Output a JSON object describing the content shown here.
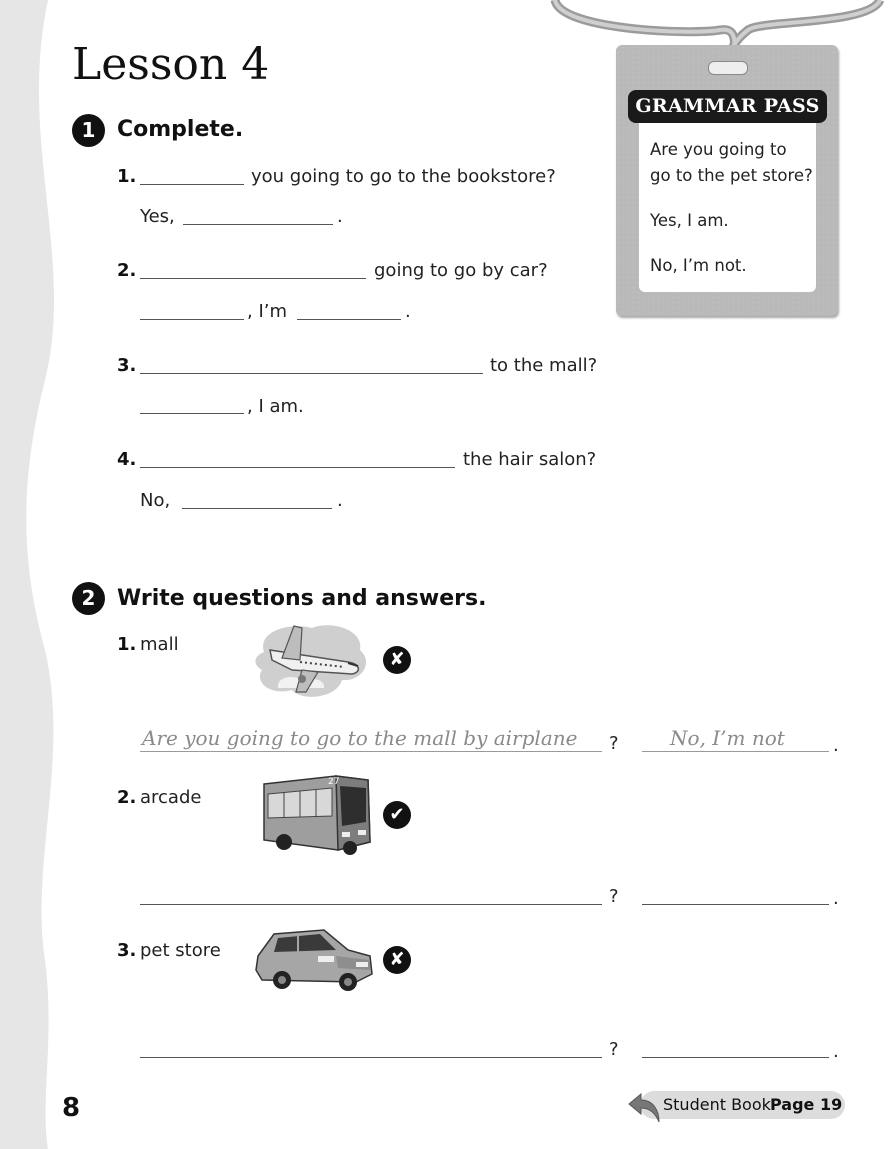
{
  "lesson": {
    "title": "Lesson 4"
  },
  "section1": {
    "number": "1",
    "title": "Complete.",
    "items": [
      {
        "number": "1.",
        "question_text": "you going to go to the bookstore?",
        "answer_prefix": "Yes,",
        "answer_suffix": "."
      },
      {
        "number": "2.",
        "question_text": "going to go by car?",
        "answer_mid": ", I’m",
        "answer_suffix": "."
      },
      {
        "number": "3.",
        "question_text": "to the mall?",
        "answer_text": ", I am."
      },
      {
        "number": "4.",
        "question_text": "the hair salon?",
        "answer_prefix": "No,",
        "answer_suffix": "."
      }
    ]
  },
  "grammar_pass": {
    "title": "GRAMMAR PASS",
    "lines": [
      "Are you going to",
      "go to the pet store?",
      "Yes, I am.",
      "No, I’m not."
    ]
  },
  "section2": {
    "number": "2",
    "title": "Write questions and answers.",
    "items": [
      {
        "number": "1.",
        "place": "mall",
        "picture": "airplane-icon",
        "mark": "✘",
        "example_question": "Are you going to go to the mall by airplane",
        "example_answer": "No, I’m not"
      },
      {
        "number": "2.",
        "place": "arcade",
        "picture": "bus-icon",
        "mark": "✔"
      },
      {
        "number": "3.",
        "place": "pet store",
        "picture": "car-icon",
        "mark": "✘"
      }
    ],
    "question_mark": "?",
    "period": "."
  },
  "footer": {
    "page_number": "8",
    "student_book_label": "Student Book",
    "page_ref": "Page 19"
  }
}
